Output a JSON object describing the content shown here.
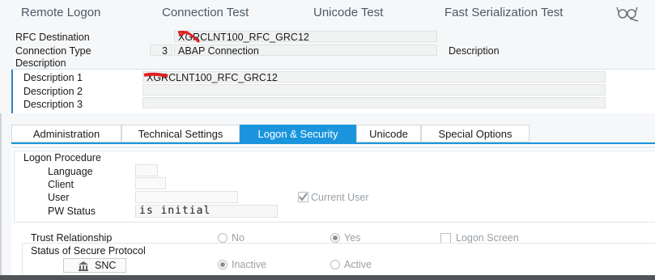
{
  "toolbar": {
    "remote_logon": "Remote Logon",
    "connection_test": "Connection Test",
    "unicode_test": "Unicode Test",
    "fast_serialization_test": "Fast Serialization Test",
    "display_icon": "glasses-icon"
  },
  "header": {
    "rfc_destination_label": "RFC Destination",
    "rfc_destination_value": "XGRCLNT100_RFC_GRC12",
    "connection_type_label": "Connection Type",
    "connection_type_code": "3",
    "connection_type_value": "ABAP Connection",
    "connection_type_desc_label": "Description",
    "description_section_label": "Description"
  },
  "descriptions": {
    "d1_label": "Description 1",
    "d1_value": "XGRCLNT100_RFC_GRC12",
    "d2_label": "Description 2",
    "d2_value": "",
    "d3_label": "Description 3",
    "d3_value": ""
  },
  "tabs": [
    {
      "label": "Administration"
    },
    {
      "label": "Technical Settings"
    },
    {
      "label": "Logon & Security",
      "active": true
    },
    {
      "label": "Unicode"
    },
    {
      "label": "Special Options"
    }
  ],
  "logon": {
    "section_label": "Logon Procedure",
    "language_label": "Language",
    "language_value": "",
    "client_label": "Client",
    "client_value": "",
    "user_label": "User",
    "user_value": "",
    "current_user_label": "Current User",
    "current_user_checked": true,
    "pw_status_label": "PW Status",
    "pw_status_value": "is initial"
  },
  "trust": {
    "label": "Trust Relationship",
    "no_label": "No",
    "yes_label": "Yes",
    "selected": "Yes",
    "logon_screen_label": "Logon Screen"
  },
  "secure": {
    "label": "Status of Secure Protocol",
    "snc_button": "SNC",
    "inactive_label": "Inactive",
    "active_label": "Active",
    "selected": "Inactive"
  },
  "colors": {
    "accent": "#1a95dd",
    "redaction": "#e02020"
  }
}
